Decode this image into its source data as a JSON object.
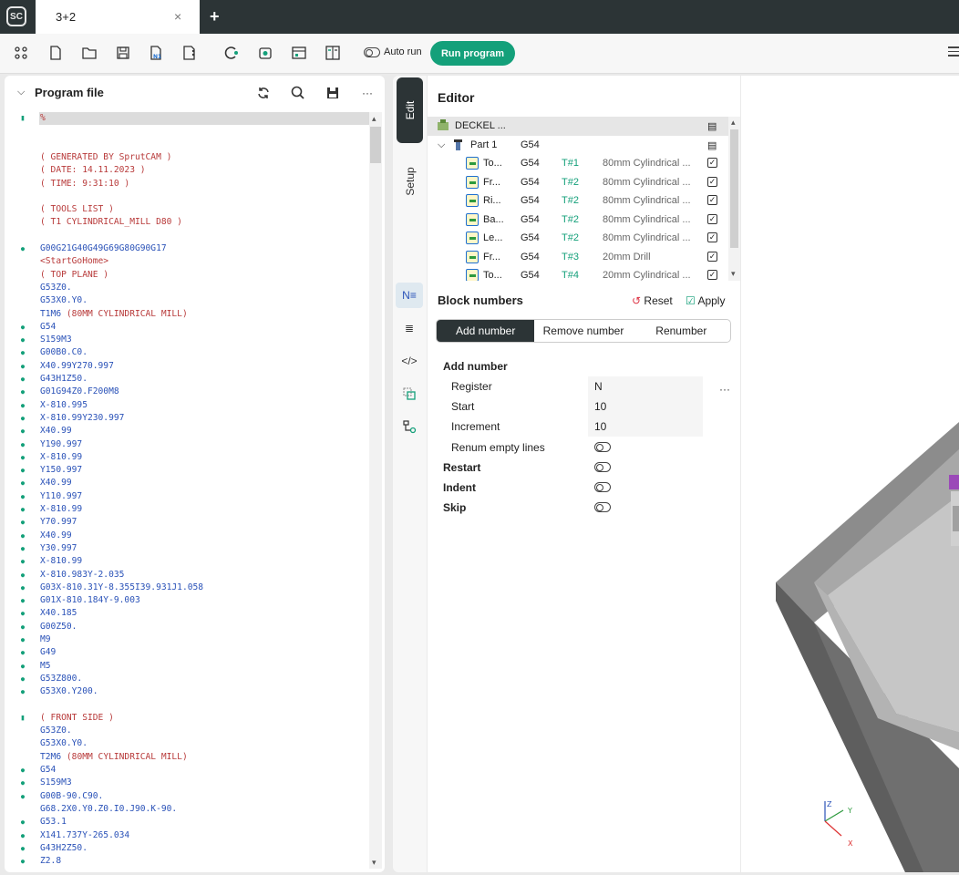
{
  "window": {
    "tab_title": "3+2",
    "tab_close": "×",
    "new_tab": "+",
    "logo_text": "SC"
  },
  "toolbar": {
    "auto_run_label": "Auto run",
    "run_program_label": "Run program"
  },
  "program_panel": {
    "title": "Program file",
    "lines": [
      {
        "mark": "bookmark",
        "text": "%",
        "kind": "comment",
        "hl": true
      },
      {
        "mark": "",
        "text": "",
        "kind": "plain"
      },
      {
        "mark": "",
        "text": "",
        "kind": "plain"
      },
      {
        "mark": "",
        "text": "( GENERATED BY SprutCAM )",
        "kind": "comment"
      },
      {
        "mark": "",
        "text": "( DATE: 14.11.2023 )",
        "kind": "comment"
      },
      {
        "mark": "",
        "text": "( TIME: 9:31:10 )",
        "kind": "comment"
      },
      {
        "mark": "",
        "text": "",
        "kind": "plain"
      },
      {
        "mark": "",
        "text": "( TOOLS LIST )",
        "kind": "comment"
      },
      {
        "mark": "",
        "text": "( T1 CYLINDRICAL_MILL D80 )",
        "kind": "comment"
      },
      {
        "mark": "",
        "text": "",
        "kind": "plain"
      },
      {
        "mark": "dot",
        "text": "G00G21G40G49G69G80G90G17",
        "kind": "code"
      },
      {
        "mark": "",
        "text": "<StartGoHome>",
        "kind": "comment"
      },
      {
        "mark": "",
        "text": "( TOP PLANE )",
        "kind": "comment"
      },
      {
        "mark": "",
        "text": "G53Z0.",
        "kind": "code"
      },
      {
        "mark": "",
        "text": "G53X0.Y0.",
        "kind": "code"
      },
      {
        "mark": "",
        "text": "T1M6 (80MM CYLINDRICAL MILL)",
        "kind": "mixed",
        "code": "T1M6 ",
        "comment": "(80MM CYLINDRICAL MILL)"
      },
      {
        "mark": "dot",
        "text": "G54",
        "kind": "code"
      },
      {
        "mark": "dot",
        "text": "S159M3",
        "kind": "code"
      },
      {
        "mark": "dot",
        "text": "G00B0.C0.",
        "kind": "code"
      },
      {
        "mark": "dot",
        "text": "X40.99Y270.997",
        "kind": "code"
      },
      {
        "mark": "dot",
        "text": "G43H1Z50.",
        "kind": "code"
      },
      {
        "mark": "dot",
        "text": "G01G94Z0.F200M8",
        "kind": "code"
      },
      {
        "mark": "dot",
        "text": "X-810.995",
        "kind": "code"
      },
      {
        "mark": "dot",
        "text": "X-810.99Y230.997",
        "kind": "code"
      },
      {
        "mark": "dot",
        "text": "X40.99",
        "kind": "code"
      },
      {
        "mark": "dot",
        "text": "Y190.997",
        "kind": "code"
      },
      {
        "mark": "dot",
        "text": "X-810.99",
        "kind": "code"
      },
      {
        "mark": "dot",
        "text": "Y150.997",
        "kind": "code"
      },
      {
        "mark": "dot",
        "text": "X40.99",
        "kind": "code"
      },
      {
        "mark": "dot",
        "text": "Y110.997",
        "kind": "code"
      },
      {
        "mark": "dot",
        "text": "X-810.99",
        "kind": "code"
      },
      {
        "mark": "dot",
        "text": "Y70.997",
        "kind": "code"
      },
      {
        "mark": "dot",
        "text": "X40.99",
        "kind": "code"
      },
      {
        "mark": "dot",
        "text": "Y30.997",
        "kind": "code"
      },
      {
        "mark": "dot",
        "text": "X-810.99",
        "kind": "code"
      },
      {
        "mark": "dot",
        "text": "X-810.983Y-2.035",
        "kind": "code"
      },
      {
        "mark": "dot",
        "text": "G03X-810.31Y-8.355I39.931J1.058",
        "kind": "code"
      },
      {
        "mark": "dot",
        "text": "G01X-810.184Y-9.003",
        "kind": "code"
      },
      {
        "mark": "dot",
        "text": "X40.185",
        "kind": "code"
      },
      {
        "mark": "dot",
        "text": "G00Z50.",
        "kind": "code"
      },
      {
        "mark": "dot",
        "text": "M9",
        "kind": "code"
      },
      {
        "mark": "dot",
        "text": "G49",
        "kind": "code"
      },
      {
        "mark": "dot",
        "text": "M5",
        "kind": "code"
      },
      {
        "mark": "dot",
        "text": "G53Z800.",
        "kind": "code"
      },
      {
        "mark": "dot",
        "text": "G53X0.Y200.",
        "kind": "code"
      },
      {
        "mark": "",
        "text": "",
        "kind": "plain"
      },
      {
        "mark": "bookmark",
        "text": "( FRONT SIDE )",
        "kind": "comment"
      },
      {
        "mark": "",
        "text": "G53Z0.",
        "kind": "code"
      },
      {
        "mark": "",
        "text": "G53X0.Y0.",
        "kind": "code"
      },
      {
        "mark": "",
        "text": "T2M6 (80MM CYLINDRICAL MILL)",
        "kind": "mixed",
        "code": "T2M6 ",
        "comment": "(80MM CYLINDRICAL MILL)"
      },
      {
        "mark": "dot",
        "text": "G54",
        "kind": "code"
      },
      {
        "mark": "dot",
        "text": "S159M3",
        "kind": "code"
      },
      {
        "mark": "dot",
        "text": "G00B-90.C90.",
        "kind": "code"
      },
      {
        "mark": "",
        "text": "G68.2X0.Y0.Z0.I0.J90.K-90.",
        "kind": "code"
      },
      {
        "mark": "dot",
        "text": "G53.1",
        "kind": "code"
      },
      {
        "mark": "dot",
        "text": "X141.737Y-265.034",
        "kind": "code"
      },
      {
        "mark": "dot",
        "text": "G43H2Z50.",
        "kind": "code"
      },
      {
        "mark": "dot",
        "text": "Z2.8",
        "kind": "code"
      }
    ]
  },
  "side_tabs": {
    "edit": "Edit",
    "setup": "Setup"
  },
  "editor": {
    "title": "Editor",
    "machine": "DECKEL ...",
    "part": {
      "name": "Part 1",
      "wcs": "G54"
    },
    "operations": [
      {
        "name": "To...",
        "wcs": "G54",
        "tool": "T#1",
        "desc": "80mm Cylindrical ..."
      },
      {
        "name": "Fr...",
        "wcs": "G54",
        "tool": "T#2",
        "desc": "80mm Cylindrical ..."
      },
      {
        "name": "Ri...",
        "wcs": "G54",
        "tool": "T#2",
        "desc": "80mm Cylindrical ..."
      },
      {
        "name": "Ba...",
        "wcs": "G54",
        "tool": "T#2",
        "desc": "80mm Cylindrical ..."
      },
      {
        "name": "Le...",
        "wcs": "G54",
        "tool": "T#2",
        "desc": "80mm Cylindrical ..."
      },
      {
        "name": "Fr...",
        "wcs": "G54",
        "tool": "T#3",
        "desc": "20mm Drill"
      },
      {
        "name": "To...",
        "wcs": "G54",
        "tool": "T#4",
        "desc": "20mm Cylindrical ..."
      }
    ]
  },
  "block_numbers": {
    "title": "Block numbers",
    "reset_label": "Reset",
    "apply_label": "Apply",
    "tabs": [
      "Add number",
      "Remove number",
      "Renumber"
    ],
    "section_title": "Add number",
    "register_label": "Register",
    "register_value": "N",
    "start_label": "Start",
    "start_value": "10",
    "increment_label": "Increment",
    "increment_value": "10",
    "renum_empty_label": "Renum empty lines",
    "restart_label": "Restart",
    "indent_label": "Indent",
    "skip_label": "Skip",
    "more": "···"
  },
  "viewport": {
    "axis_x": "X",
    "axis_y": "Y",
    "axis_z": "Z"
  },
  "colors": {
    "accent": "#14a07a",
    "dark": "#2c3436",
    "code_blue": "#2a52b8",
    "comment_red": "#b83a3a"
  }
}
